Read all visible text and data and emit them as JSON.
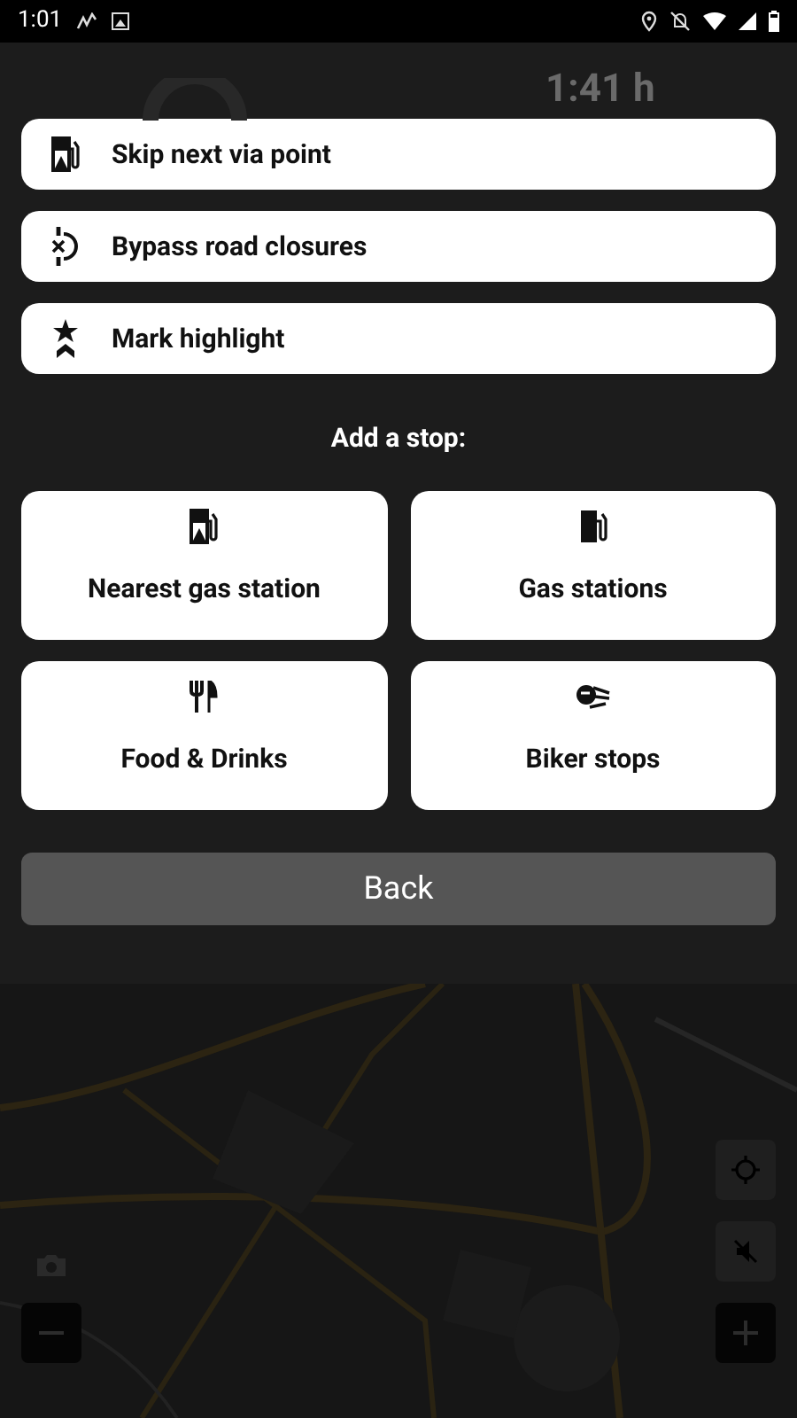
{
  "status_bar": {
    "time": "1:01"
  },
  "route_info": {
    "duration": "1:41 h"
  },
  "actions": [
    {
      "label": "Skip next via point"
    },
    {
      "label": "Bypass road closures"
    },
    {
      "label": "Mark highlight"
    }
  ],
  "stop_heading": "Add a stop:",
  "stops": [
    {
      "label": "Nearest gas station"
    },
    {
      "label": "Gas stations"
    },
    {
      "label": "Food & Drinks"
    },
    {
      "label": "Biker stops"
    }
  ],
  "back_button": "Back"
}
